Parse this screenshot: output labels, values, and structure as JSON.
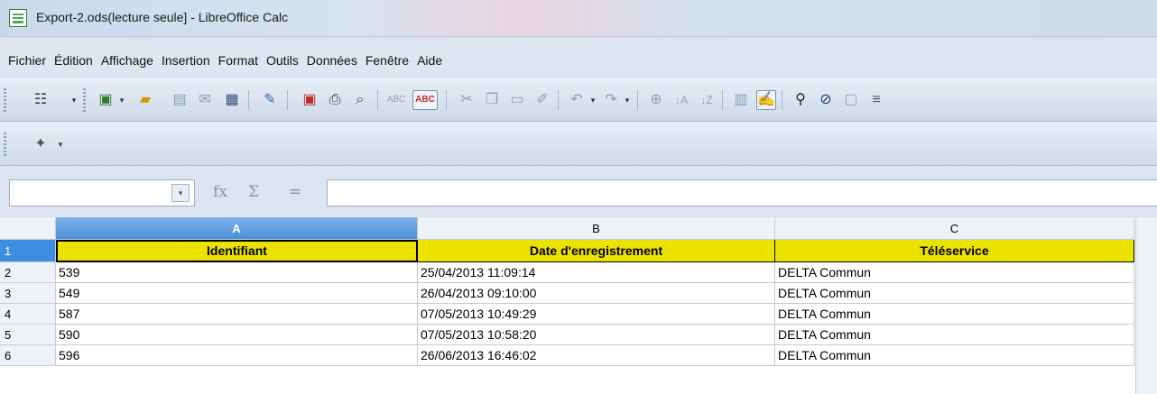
{
  "window": {
    "title": "Export-2.ods(lecture seule] - LibreOffice Calc",
    "app_icon": "calc-icon"
  },
  "menu": [
    "Fichier",
    "Édition",
    "Affichage",
    "Insertion",
    "Format",
    "Outils",
    "Données",
    "Fenêtre",
    "Aide"
  ],
  "toolbar": {
    "icons": [
      "new-icon",
      "open-icon",
      "save-icon",
      "email-icon",
      "save-as-icon",
      "edit-icon",
      "export-pdf-icon",
      "print-icon",
      "print-preview-icon",
      "spellcheck-icon",
      "autospell-icon",
      "cut-icon",
      "copy-icon",
      "paste-icon",
      "clone-format-icon",
      "undo-icon",
      "redo-icon",
      "hyperlink-icon",
      "sort-asc-icon",
      "sort-desc-icon",
      "chart-icon",
      "draw-icon",
      "find-icon",
      "navigator-icon",
      "gallery-icon",
      "datasource-icon"
    ],
    "second_row_icons": [
      "insert-icon"
    ]
  },
  "formula_bar": {
    "name_box_value": "",
    "function_wizard": "fx",
    "sum_symbol": "Σ",
    "equals_symbol": "=",
    "formula_value": ""
  },
  "sheet": {
    "columns": [
      "A",
      "B",
      "C"
    ],
    "selected_column": "A",
    "row_numbers": [
      "1",
      "2",
      "3",
      "4",
      "5",
      "6"
    ],
    "header_row": [
      "Identifiant",
      "Date d'enregistrement",
      "Téléservice"
    ],
    "header_color": "#ebe200",
    "rows": [
      [
        "539",
        "25/04/2013 11:09:14",
        "DELTA Commun"
      ],
      [
        "549",
        "26/04/2013 09:10:00",
        "DELTA Commun"
      ],
      [
        "587",
        "07/05/2013 10:49:29",
        "DELTA Commun"
      ],
      [
        "590",
        "07/05/2013 10:58:20",
        "DELTA Commun"
      ],
      [
        "596",
        "26/06/2013 16:46:02",
        "DELTA Commun"
      ]
    ]
  }
}
